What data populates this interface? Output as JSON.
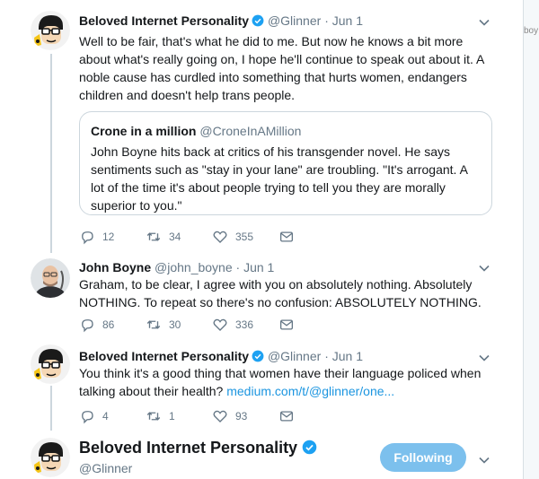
{
  "edge_text": "boy",
  "tweets": [
    {
      "name": "Beloved Internet Personality",
      "handle": "@Glinner",
      "sep": "·",
      "date": "Jun 1",
      "text": "Well to be fair, that's what he did to me. But now he knows a bit more about what's really going on, I hope he'll continue to speak out about it. A noble cause has curdled into something that hurts women, endangers children and doesn't help trans people.",
      "quote": {
        "name": "Crone in a million",
        "handle": "@CroneInAMillion",
        "text": "John Boyne hits back at critics of his transgender novel. He says sentiments such as \"stay in your lane\" are troubling. \"It's arrogant. A lot of the time it's about people trying to tell you they are morally superior to you.\""
      },
      "replies": "12",
      "retweets": "34",
      "likes": "355"
    },
    {
      "name": "John Boyne",
      "handle": "@john_boyne",
      "sep": "·",
      "date": "Jun 1",
      "text": "Graham, to be clear, I agree with you on absolutely nothing. Absolutely NOTHING. To repeat so there's no confusion: ABSOLUTELY NOTHING.",
      "replies": "86",
      "retweets": "30",
      "likes": "336"
    },
    {
      "name": "Beloved Internet Personality",
      "handle": "@Glinner",
      "sep": "·",
      "date": "Jun 1",
      "text": "You think it's a good thing that women have their language policed when talking about their health?",
      "link": "medium.com/t/@glinner/one...",
      "replies": "4",
      "retweets": "1",
      "likes": "93"
    }
  ],
  "focused": {
    "name": "Beloved Internet Personality",
    "handle": "@Glinner",
    "follow_label": "Following"
  },
  "icons": {
    "reply": "reply-icon",
    "retweet": "retweet-icon",
    "like": "heart-icon",
    "dm": "envelope-icon",
    "verified": "verified-badge-icon",
    "caret": "chevron-down-icon"
  },
  "colors": {
    "accent": "#1da1f2",
    "follow_button": "#7cc0ed",
    "muted": "#657786"
  }
}
